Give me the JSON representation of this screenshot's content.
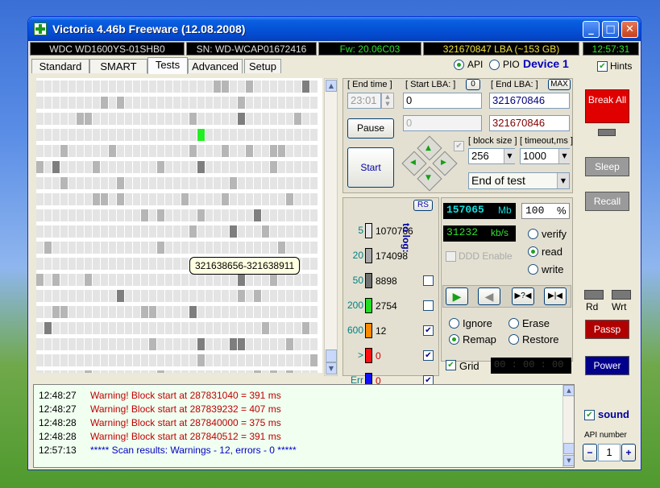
{
  "window": {
    "title": "Victoria 4.46b Freeware (12.08.2008)",
    "clock": "12:57:31"
  },
  "status": {
    "model": "WDC WD1600YS-01SHB0",
    "serial": "SN: WD-WCAP01672416",
    "firmware": "Fw: 20.06C03",
    "lba": "321670847 LBA (~153 GB)"
  },
  "tabs": [
    "Standard",
    "SMART",
    "Tests",
    "Advanced",
    "Setup"
  ],
  "active_tab": "Tests",
  "mode": {
    "api_label": "API",
    "pio_label": "PIO",
    "device": "Device 1",
    "hints_label": "Hints",
    "api_selected": true
  },
  "grid": {
    "tooltip": "321638656-321638911"
  },
  "controls": {
    "end_time_label": "[ End time ]",
    "end_time_value": "23:01",
    "start_lba_label": "[ Start LBA: ]",
    "start_lba_zero": "0",
    "start_lba_value": "0",
    "start_lba_current": "0",
    "end_lba_label": "[ End LBA: ]",
    "end_lba_max": "MAX",
    "end_lba_value": "321670846",
    "end_lba_current": "321670846",
    "pause_label": "Pause",
    "start_label": "Start",
    "block_size_label": "[ block size ]",
    "block_size_value": "256",
    "timeout_label": "[ timeout,ms ]",
    "timeout_value": "1000",
    "end_action": "End of test"
  },
  "stats": {
    "rs_label": "RS",
    "to_log_label": "to log:",
    "rows": [
      {
        "label": "5",
        "count": "1070766",
        "color": "#e6e6e6"
      },
      {
        "label": "20",
        "count": "174098",
        "color": "#a8a8a8"
      },
      {
        "label": "50",
        "count": "8898",
        "color": "#707070"
      },
      {
        "label": "200",
        "count": "2754",
        "color": "#22dd22"
      },
      {
        "label": "600",
        "count": "12",
        "color": "#ff8a00"
      },
      {
        "label": ">",
        "count": "0",
        "color": "#ff1010"
      },
      {
        "label": "Err",
        "count": "0",
        "color": "#1010ff"
      }
    ]
  },
  "progress": {
    "mb": "157065",
    "mb_unit": "Mb",
    "percent": "100",
    "percent_unit": "%",
    "speed": "31232",
    "speed_unit": "kb/s",
    "ddd_label": "DDD Enable"
  },
  "read_mode": {
    "options": [
      "verify",
      "read",
      "write"
    ],
    "selected": "read"
  },
  "actions": {
    "options": [
      "Ignore",
      "Erase",
      "Remap",
      "Restore"
    ],
    "selected": "Remap",
    "grid_label": "Grid",
    "timer": "00 : 00 : 00"
  },
  "side": {
    "break_label": "Break All",
    "sleep_label": "Sleep",
    "recall_label": "Recall",
    "rd_label": "Rd",
    "wrt_label": "Wrt",
    "passp_label": "Passp",
    "power_label": "Power",
    "sound_label": "sound",
    "api_number_label": "API number",
    "api_number_value": "1"
  },
  "log": [
    {
      "time": "12:48:27",
      "text": "Warning! Block start at 287831040 = 391 ms",
      "color": "#c00000"
    },
    {
      "time": "12:48:27",
      "text": "Warning! Block start at 287839232 = 407 ms",
      "color": "#c00000"
    },
    {
      "time": "12:48:28",
      "text": "Warning! Block start at 287840000 = 375 ms",
      "color": "#c00000"
    },
    {
      "time": "12:48:28",
      "text": "Warning! Block start at 287840512 = 391 ms",
      "color": "#c00000"
    },
    {
      "time": "12:57:13",
      "text": "***** Scan results: Warnings - 12, errors - 0 *****",
      "color": "#0000c0"
    }
  ]
}
